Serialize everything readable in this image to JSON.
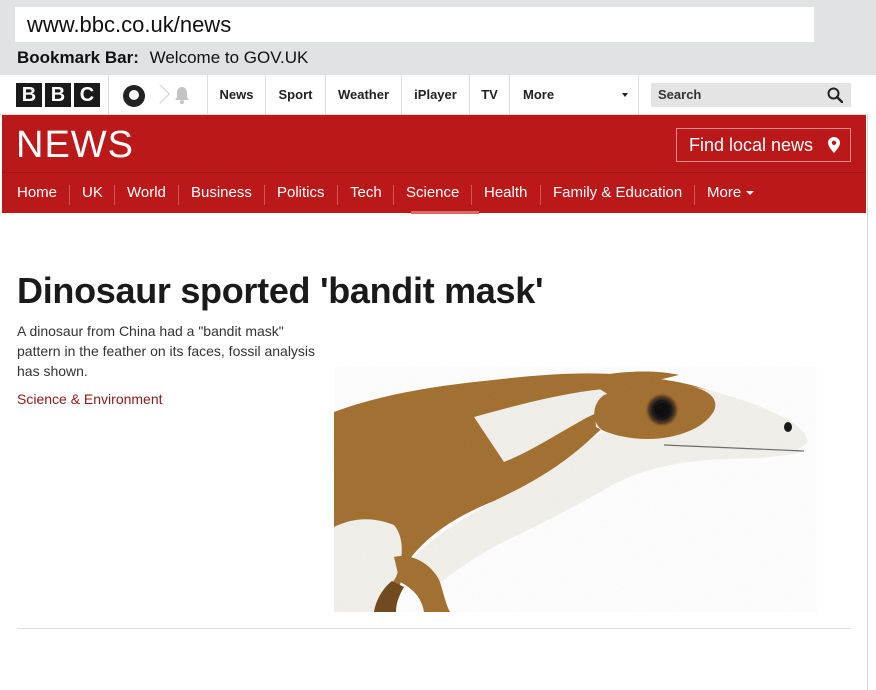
{
  "browser": {
    "url": "www.bbc.co.uk/news",
    "bookmark_label": "Bookmark Bar:",
    "bookmarks": [
      "Welcome to GOV.UK"
    ]
  },
  "topnav": {
    "logo": [
      "B",
      "B",
      "C"
    ],
    "items": [
      "News",
      "Sport",
      "Weather",
      "iPlayer",
      "TV",
      "More"
    ],
    "search_placeholder": "Search"
  },
  "masthead": {
    "logo_text": "NEWS",
    "find_local": "Find local news"
  },
  "sections": [
    "Home",
    "UK",
    "World",
    "Business",
    "Politics",
    "Tech",
    "Science",
    "Health",
    "Family & Education",
    "More"
  ],
  "article": {
    "headline": "Dinosaur sported 'bandit mask'",
    "summary": "A dinosaur from China had a \"bandit mask\" pattern in the feather on its faces, fossil analysis has shown.",
    "section": "Science & Environment"
  },
  "colors": {
    "bbc_red": "#bb1919",
    "chrome_bg": "#dfe3e3",
    "dino_brown": "#a06d2b",
    "dino_white": "#f2f0ea"
  },
  "icons": [
    "account-icon",
    "bell-icon",
    "search-icon",
    "location-pin-icon",
    "caret-down-icon"
  ]
}
